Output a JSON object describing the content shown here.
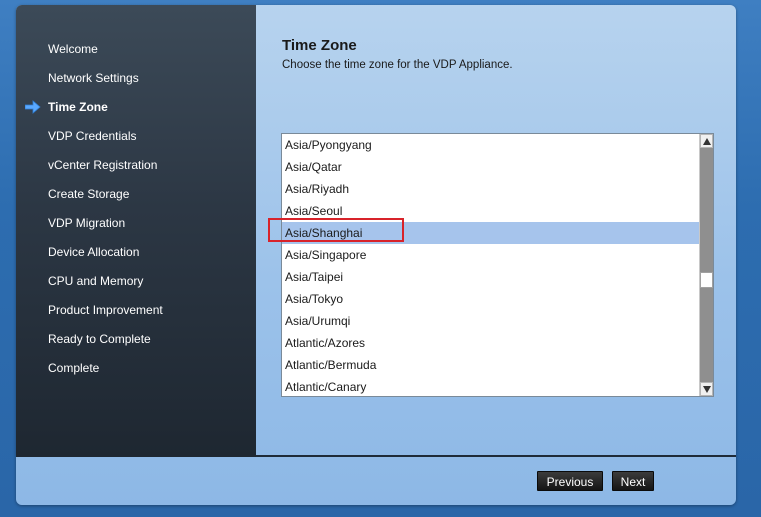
{
  "sidebar": {
    "items": [
      {
        "label": "Welcome"
      },
      {
        "label": "Network Settings"
      },
      {
        "label": "Time Zone",
        "active": true
      },
      {
        "label": "VDP Credentials"
      },
      {
        "label": "vCenter Registration"
      },
      {
        "label": "Create Storage"
      },
      {
        "label": "VDP Migration"
      },
      {
        "label": "Device Allocation"
      },
      {
        "label": "CPU and Memory"
      },
      {
        "label": "Product Improvement"
      },
      {
        "label": "Ready to Complete"
      },
      {
        "label": "Complete"
      }
    ]
  },
  "content": {
    "title": "Time Zone",
    "subtitle": "Choose the time zone for the VDP Appliance."
  },
  "timezone_list": {
    "items": [
      "Asia/Pyongyang",
      "Asia/Qatar",
      "Asia/Riyadh",
      "Asia/Seoul",
      "Asia/Shanghai",
      "Asia/Singapore",
      "Asia/Taipei",
      "Asia/Tokyo",
      "Asia/Urumqi",
      "Atlantic/Azores",
      "Atlantic/Bermuda",
      "Atlantic/Canary"
    ],
    "selected": "Asia/Shanghai"
  },
  "footer": {
    "previous_label": "Previous",
    "next_label": "Next"
  },
  "colors": {
    "selection": "#a6c4ec",
    "highlight_box": "#d8232a",
    "active_arrow": "#5aa9ff"
  }
}
